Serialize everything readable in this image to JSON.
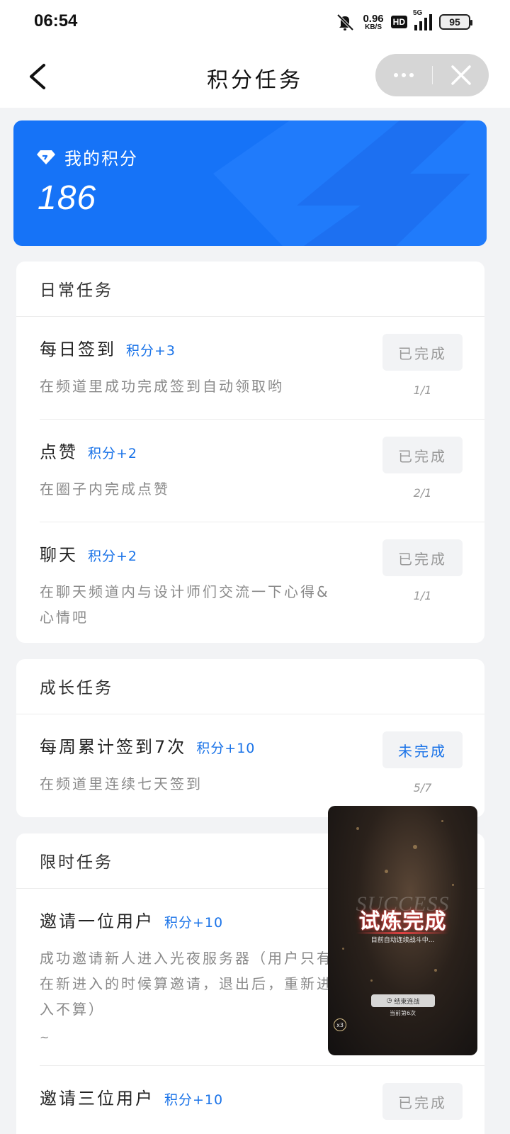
{
  "status_bar": {
    "time": "06:54",
    "speed_value": "0.96",
    "speed_unit": "KB/S",
    "hd": "HD",
    "network": "5G",
    "battery": "95"
  },
  "header": {
    "title": "积分任务"
  },
  "points_card": {
    "label": "我的积分",
    "value": "186"
  },
  "sections": {
    "daily": {
      "title": "日常任务",
      "tasks": [
        {
          "name": "每日签到",
          "points": "积分+3",
          "desc": "在频道里成功完成签到自动领取哟",
          "status": "已完成",
          "progress": "1/1"
        },
        {
          "name": "点赞",
          "points": "积分+2",
          "desc": "在圈子内完成点赞",
          "status": "已完成",
          "progress": "2/1"
        },
        {
          "name": "聊天",
          "points": "积分+2",
          "desc": "在聊天频道内与设计师们交流一下心得&心情吧",
          "status": "已完成",
          "progress": "1/1"
        }
      ]
    },
    "growth": {
      "title": "成长任务",
      "tasks": [
        {
          "name": "每周累计签到7次",
          "points": "积分+10",
          "desc": "在频道里连续七天签到",
          "status": "未完成",
          "progress": "5/7"
        }
      ]
    },
    "limited": {
      "title": "限时任务",
      "tasks": [
        {
          "name": "邀请一位用户",
          "points": "积分+10",
          "desc": "成功邀请新人进入光夜服务器（用户只有在新进入的时候算邀请，退出后，重新进入不算）",
          "extra": "~"
        },
        {
          "name": "邀请三位用户",
          "points": "积分+10",
          "status": "已完成"
        }
      ]
    }
  },
  "floating_video": {
    "ghost_text": "SUCCESS",
    "main_text": "试炼完成",
    "subtitle": "目前自动连续战斗中...",
    "end_button": "结束连战",
    "count_text": "当前第6次",
    "speed_badge": "x3"
  },
  "colors": {
    "accent": "#1a73e8",
    "points_card": "#1673f7",
    "background": "#f2f3f5"
  }
}
